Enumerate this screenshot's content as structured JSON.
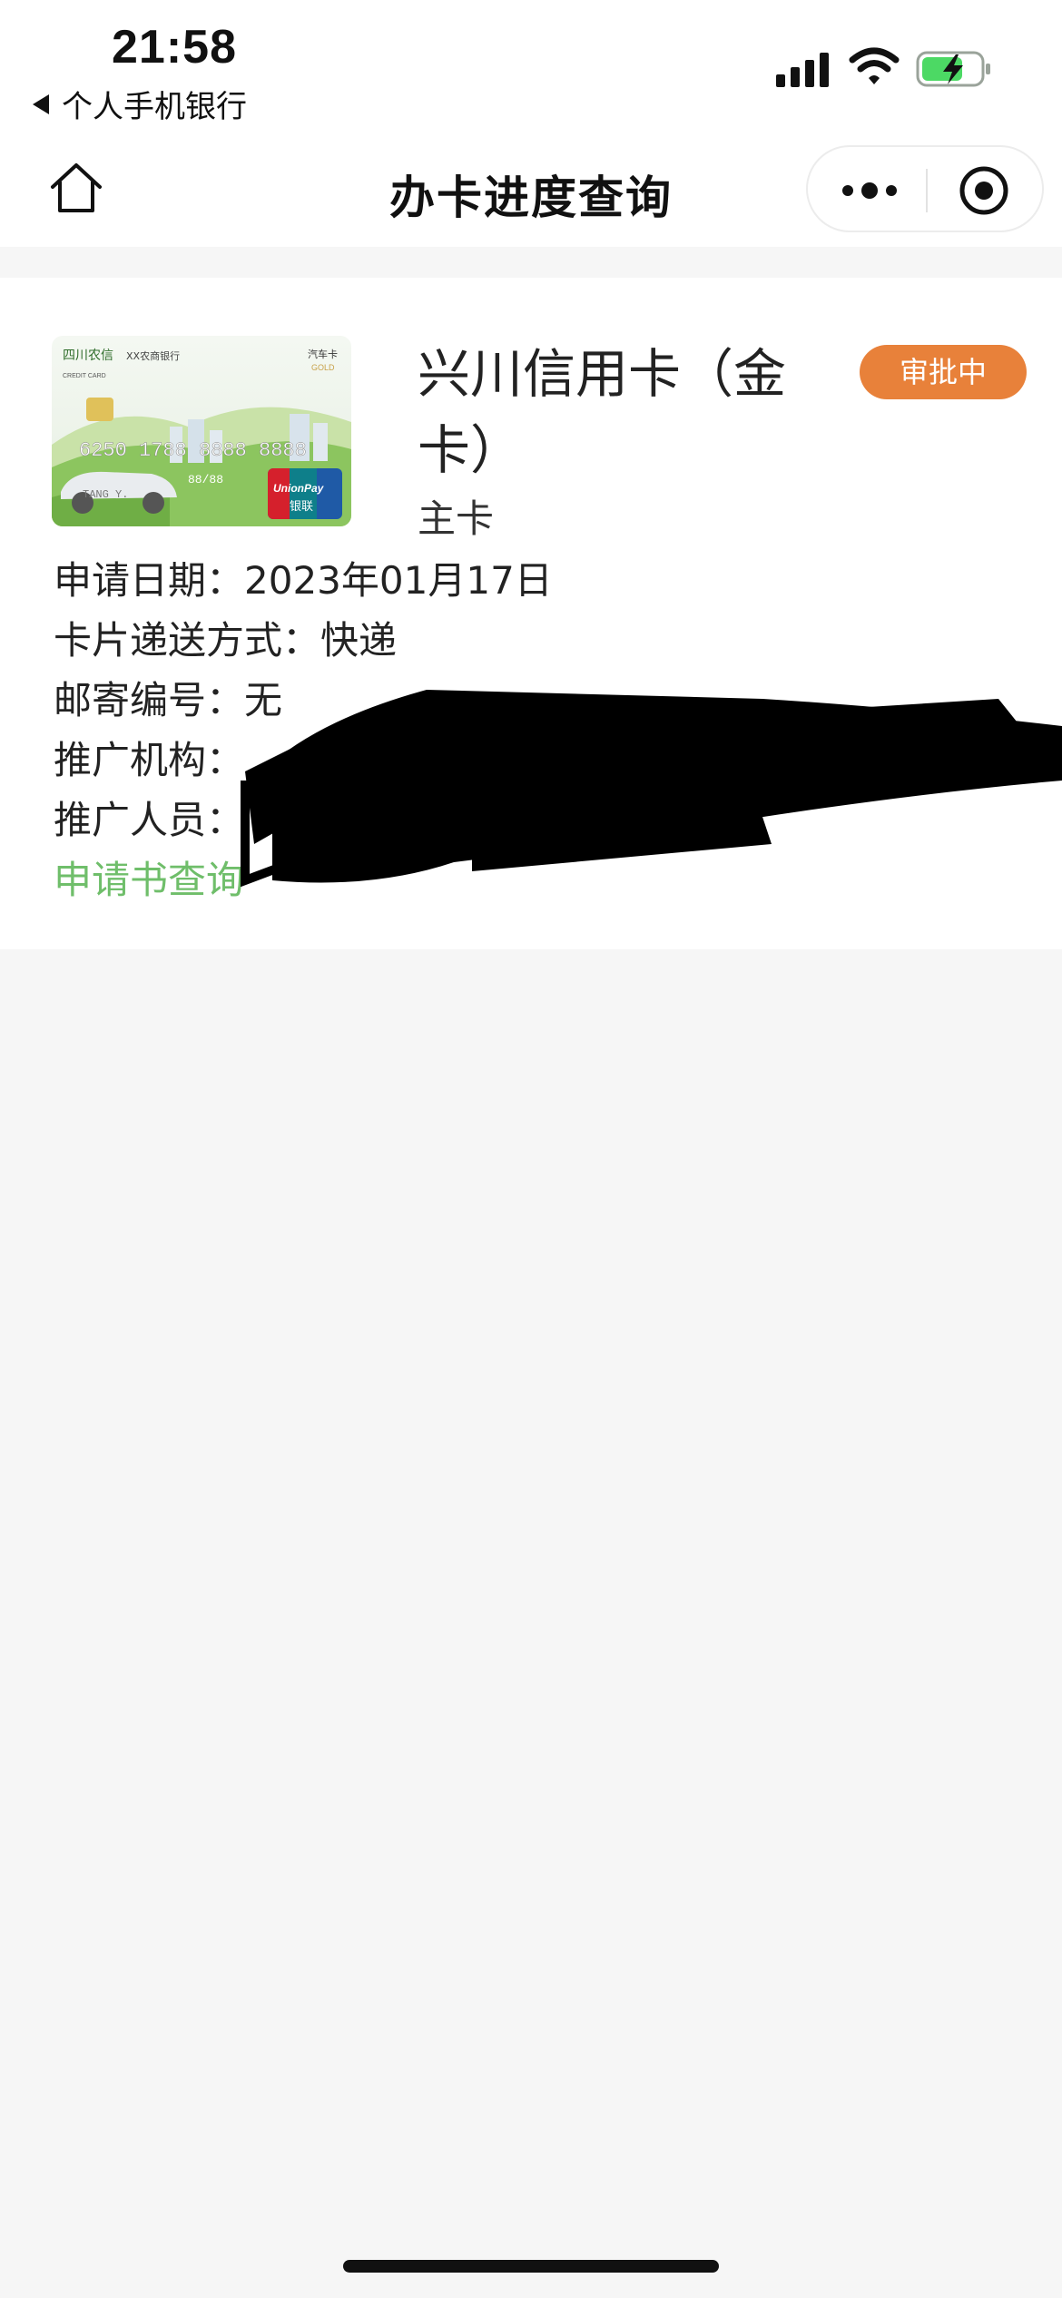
{
  "status_bar": {
    "time": "21:58",
    "back_app": "个人手机银行",
    "icons": [
      "cellular-signal-icon",
      "wifi-icon",
      "battery-charging-icon"
    ]
  },
  "nav_bar": {
    "title": "办卡进度查询",
    "home_icon": "home-icon",
    "more_icon": "more-dots-icon",
    "close_icon": "capsule-close-icon"
  },
  "card": {
    "name": "兴川信用卡（金卡）",
    "type": "主卡",
    "status": "审批中",
    "image": {
      "bank_name": "四川农信",
      "bank_sub": "XX农商银行",
      "card_label": "CREDIT CARD",
      "product_label": "汽车卡",
      "tier": "GOLD",
      "number": "6250 1788 8888 8888",
      "holder": "TANG Y.",
      "expiry": "88/88",
      "network": "UnionPay",
      "network_cn": "银联"
    }
  },
  "details": {
    "apply_date_label": "申请日期：",
    "apply_date_value": "2023年01月17日",
    "delivery_label": "卡片递送方式：",
    "delivery_value": "快递",
    "mail_no_label": "邮寄编号：",
    "mail_no_value": "无",
    "branch_label": "推广机构：",
    "staff_label": "推广人员：",
    "link_label": "申请书查询"
  },
  "colors": {
    "status_badge": "#e8813a",
    "link": "#6fbe6a",
    "page_bg": "#f6f6f6"
  }
}
